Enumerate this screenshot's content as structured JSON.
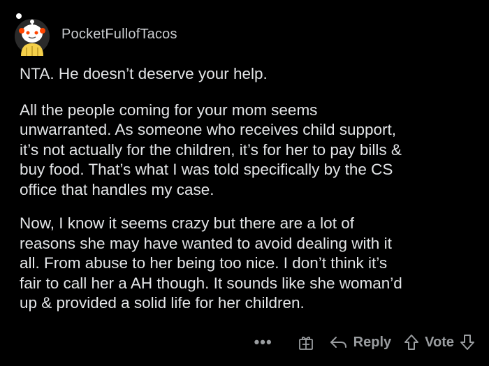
{
  "comment": {
    "username": "PocketFullofTacos",
    "paragraphs": [
      "NTA. He doesn’t deserve your help.",
      "All the people coming for your mom seems\nunwarranted. As someone who receives child support,\nit’s not actually for the children, it’s for her to pay bills &\nbuy food. That’s what I was told specifically by the CS\noffice that handles my case.",
      "Now, I know it seems crazy but there are a lot of\nreasons she may have wanted to avoid dealing with it\nall. From abuse to her being too nice. I don’t think it’s\nfair to call her a AH though. It sounds like she woman’d\nup & provided a solid life for her children."
    ]
  },
  "actions": {
    "more_label": "•••",
    "reply_label": "Reply",
    "vote_label": "Vote",
    "icons": [
      "more-icon",
      "award-icon",
      "reply-arrow-icon",
      "upvote-icon",
      "downvote-icon"
    ]
  },
  "colors": {
    "background": "#000000",
    "text": "#e3e5e7",
    "muted": "#9a9da0",
    "avatar_yellow": "#f5d04a"
  }
}
